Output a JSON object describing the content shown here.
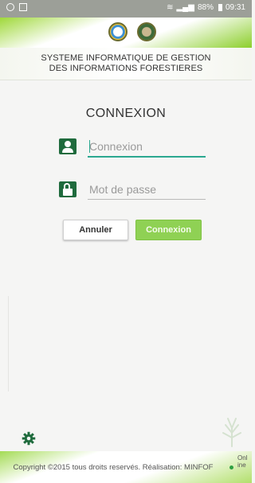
{
  "status_bar": {
    "battery": "88%",
    "time": "09:31",
    "signal_icon": "signal-icon",
    "wifi_icon": "wifi-icon"
  },
  "header": {
    "logo_left": "adf-logo",
    "logo_right": "minfof-logo"
  },
  "banner": {
    "line1": "SYSTEME INFORMATIQUE DE GESTION",
    "line2": "DES INFORMATIONS FORESTIERES"
  },
  "login": {
    "title": "CONNEXION",
    "username": {
      "placeholder": "Connexion",
      "value": "",
      "icon": "user-icon"
    },
    "password": {
      "placeholder": "Mot de passe",
      "value": "",
      "icon": "lock-icon"
    },
    "cancel_label": "Annuler",
    "submit_label": "Connexion"
  },
  "footer": {
    "copyright": "Copyright ©2015 tous droits reservés. Réalisation: MINFOF",
    "status": "Online"
  },
  "colors": {
    "brand_green": "#1f6b3d",
    "accent_green": "#8fd154",
    "focus_teal": "#2aa890"
  }
}
